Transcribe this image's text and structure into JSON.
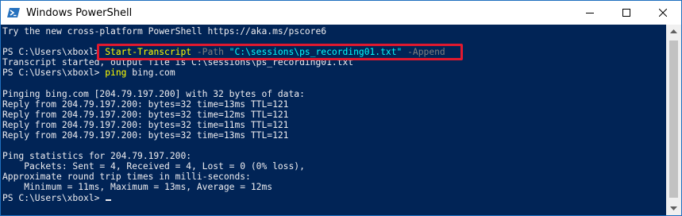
{
  "window": {
    "title": "Windows PowerShell",
    "app_icon": "powershell-icon",
    "controls": [
      "minimize-icon",
      "maximize-icon",
      "close-icon"
    ]
  },
  "colors": {
    "console_bg": "#012456",
    "text": "#eeedf0",
    "command": "#ffff00",
    "parameter": "#808080",
    "string": "#00ffff",
    "highlight": "#e0192f"
  },
  "console": {
    "line1": "Try the new cross-platform PowerShell https://aka.ms/pscore6",
    "line2": "",
    "prompt1": "PS C:\\Users\\xboxl> ",
    "cmd1_name": "Start-Transcript",
    "cmd1_param1": " -Path ",
    "cmd1_value": "\"C:\\sessions\\ps_recording01.txt\"",
    "cmd1_param2": " -Append",
    "line4": "Transcript started, output file is C:\\sessions\\ps_recording01.txt",
    "prompt2": "PS C:\\Users\\xboxl> ",
    "cmd2_name": "ping",
    "cmd2_arg": " bing.com",
    "line6": "",
    "line7": "Pinging bing.com [204.79.197.200] with 32 bytes of data:",
    "line8": "Reply from 204.79.197.200: bytes=32 time=13ms TTL=121",
    "line9": "Reply from 204.79.197.200: bytes=32 time=12ms TTL=121",
    "line10": "Reply from 204.79.197.200: bytes=32 time=11ms TTL=121",
    "line11": "Reply from 204.79.197.200: bytes=32 time=13ms TTL=121",
    "line12": "",
    "line13": "Ping statistics for 204.79.197.200:",
    "line14": "    Packets: Sent = 4, Received = 4, Lost = 0 (0% loss),",
    "line15": "Approximate round trip times in milli-seconds:",
    "line16": "    Minimum = 11ms, Maximum = 13ms, Average = 12ms",
    "prompt3": "PS C:\\Users\\xboxl> "
  }
}
